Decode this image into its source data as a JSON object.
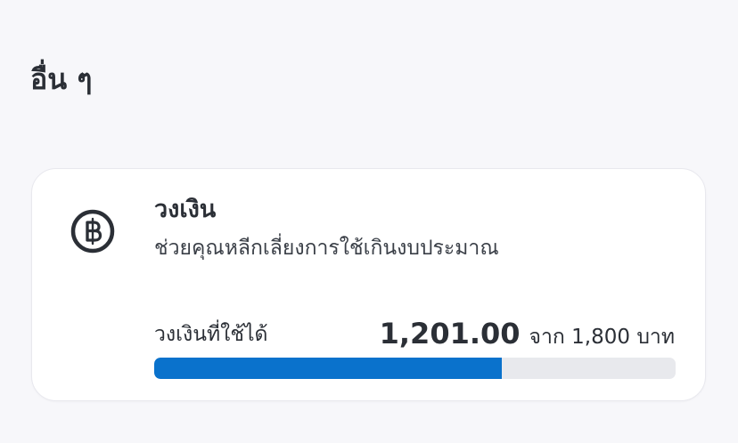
{
  "section": {
    "title": "อื่น ๆ"
  },
  "credit_limit_card": {
    "icon": "baht-coin-icon",
    "title": "วงเงิน",
    "description": "ช่วยคุณหลีกเลี่ยงการใช้เกินงบประมาณ",
    "available_label": "วงเงินที่ใช้ได้",
    "available_amount": "1,201.00",
    "total_text": "จาก 1,800 บาท",
    "progress_fraction": 0.667,
    "colors": {
      "progress_fill": "#0a72cc",
      "progress_track": "#e8e9ed"
    }
  }
}
